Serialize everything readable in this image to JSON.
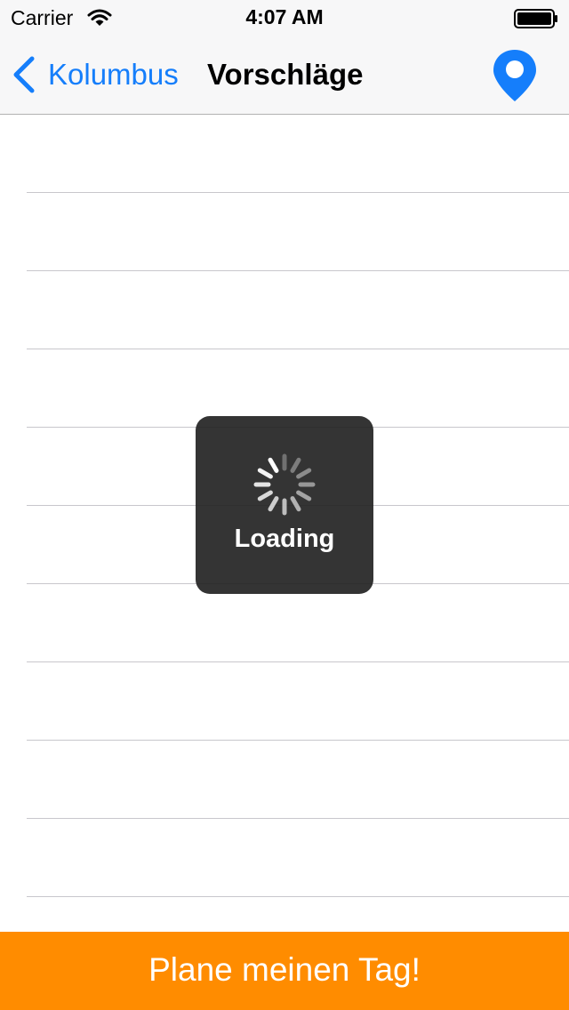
{
  "status_bar": {
    "carrier": "Carrier",
    "time": "4:07 AM"
  },
  "nav_bar": {
    "back_label": "Kolumbus",
    "title": "Vorschläge",
    "right_icon": "location-pin-icon"
  },
  "table": {
    "row_count": 10
  },
  "loading_hud": {
    "label": "Loading"
  },
  "bottom_button": {
    "label": "Plane meinen Tag!"
  },
  "colors": {
    "accent_blue": "#157efb",
    "bottom_button_orange": "#ff8c00",
    "hud_background": "#1e1e1e",
    "separator": "#c8c7cc"
  }
}
